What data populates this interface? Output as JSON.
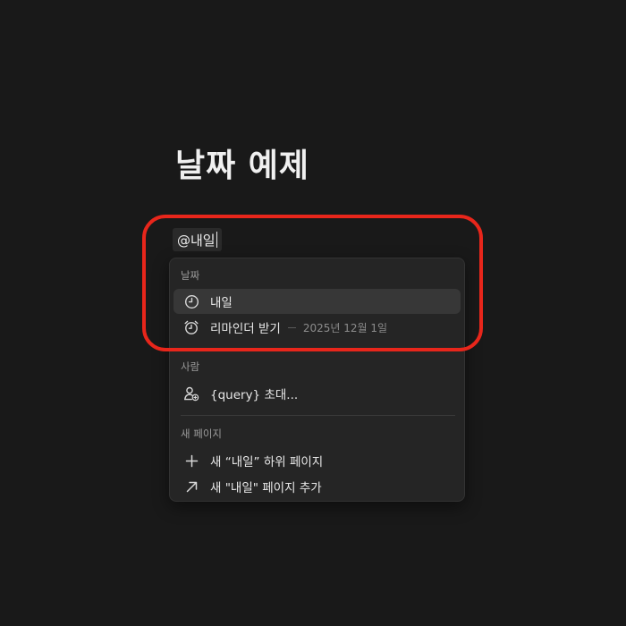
{
  "page": {
    "title": "날짜 예제"
  },
  "mention": {
    "value": "@내일"
  },
  "menu": {
    "date_section": {
      "label": "날짜",
      "items": [
        {
          "label": "내일",
          "icon": "clock-icon"
        },
        {
          "label": "리마인더 받기",
          "icon": "alarm-clock-icon",
          "detail": "2025년 12월 1일"
        }
      ]
    },
    "people_section": {
      "label": "사람",
      "items": [
        {
          "label": "{query} 초대...",
          "icon": "add-person-icon"
        }
      ]
    },
    "new_page_section": {
      "label": "새 페이지",
      "items": [
        {
          "label": "새 “내일” 하위 페이지",
          "icon": "plus-icon"
        },
        {
          "label": "새 \"내일\" 페이지 추가",
          "icon": "arrow-up-right-icon"
        }
      ]
    }
  },
  "colors": {
    "background": "#191919",
    "menu_background": "#252525",
    "selected_item": "#373737",
    "highlight_ring": "#e8261b"
  }
}
